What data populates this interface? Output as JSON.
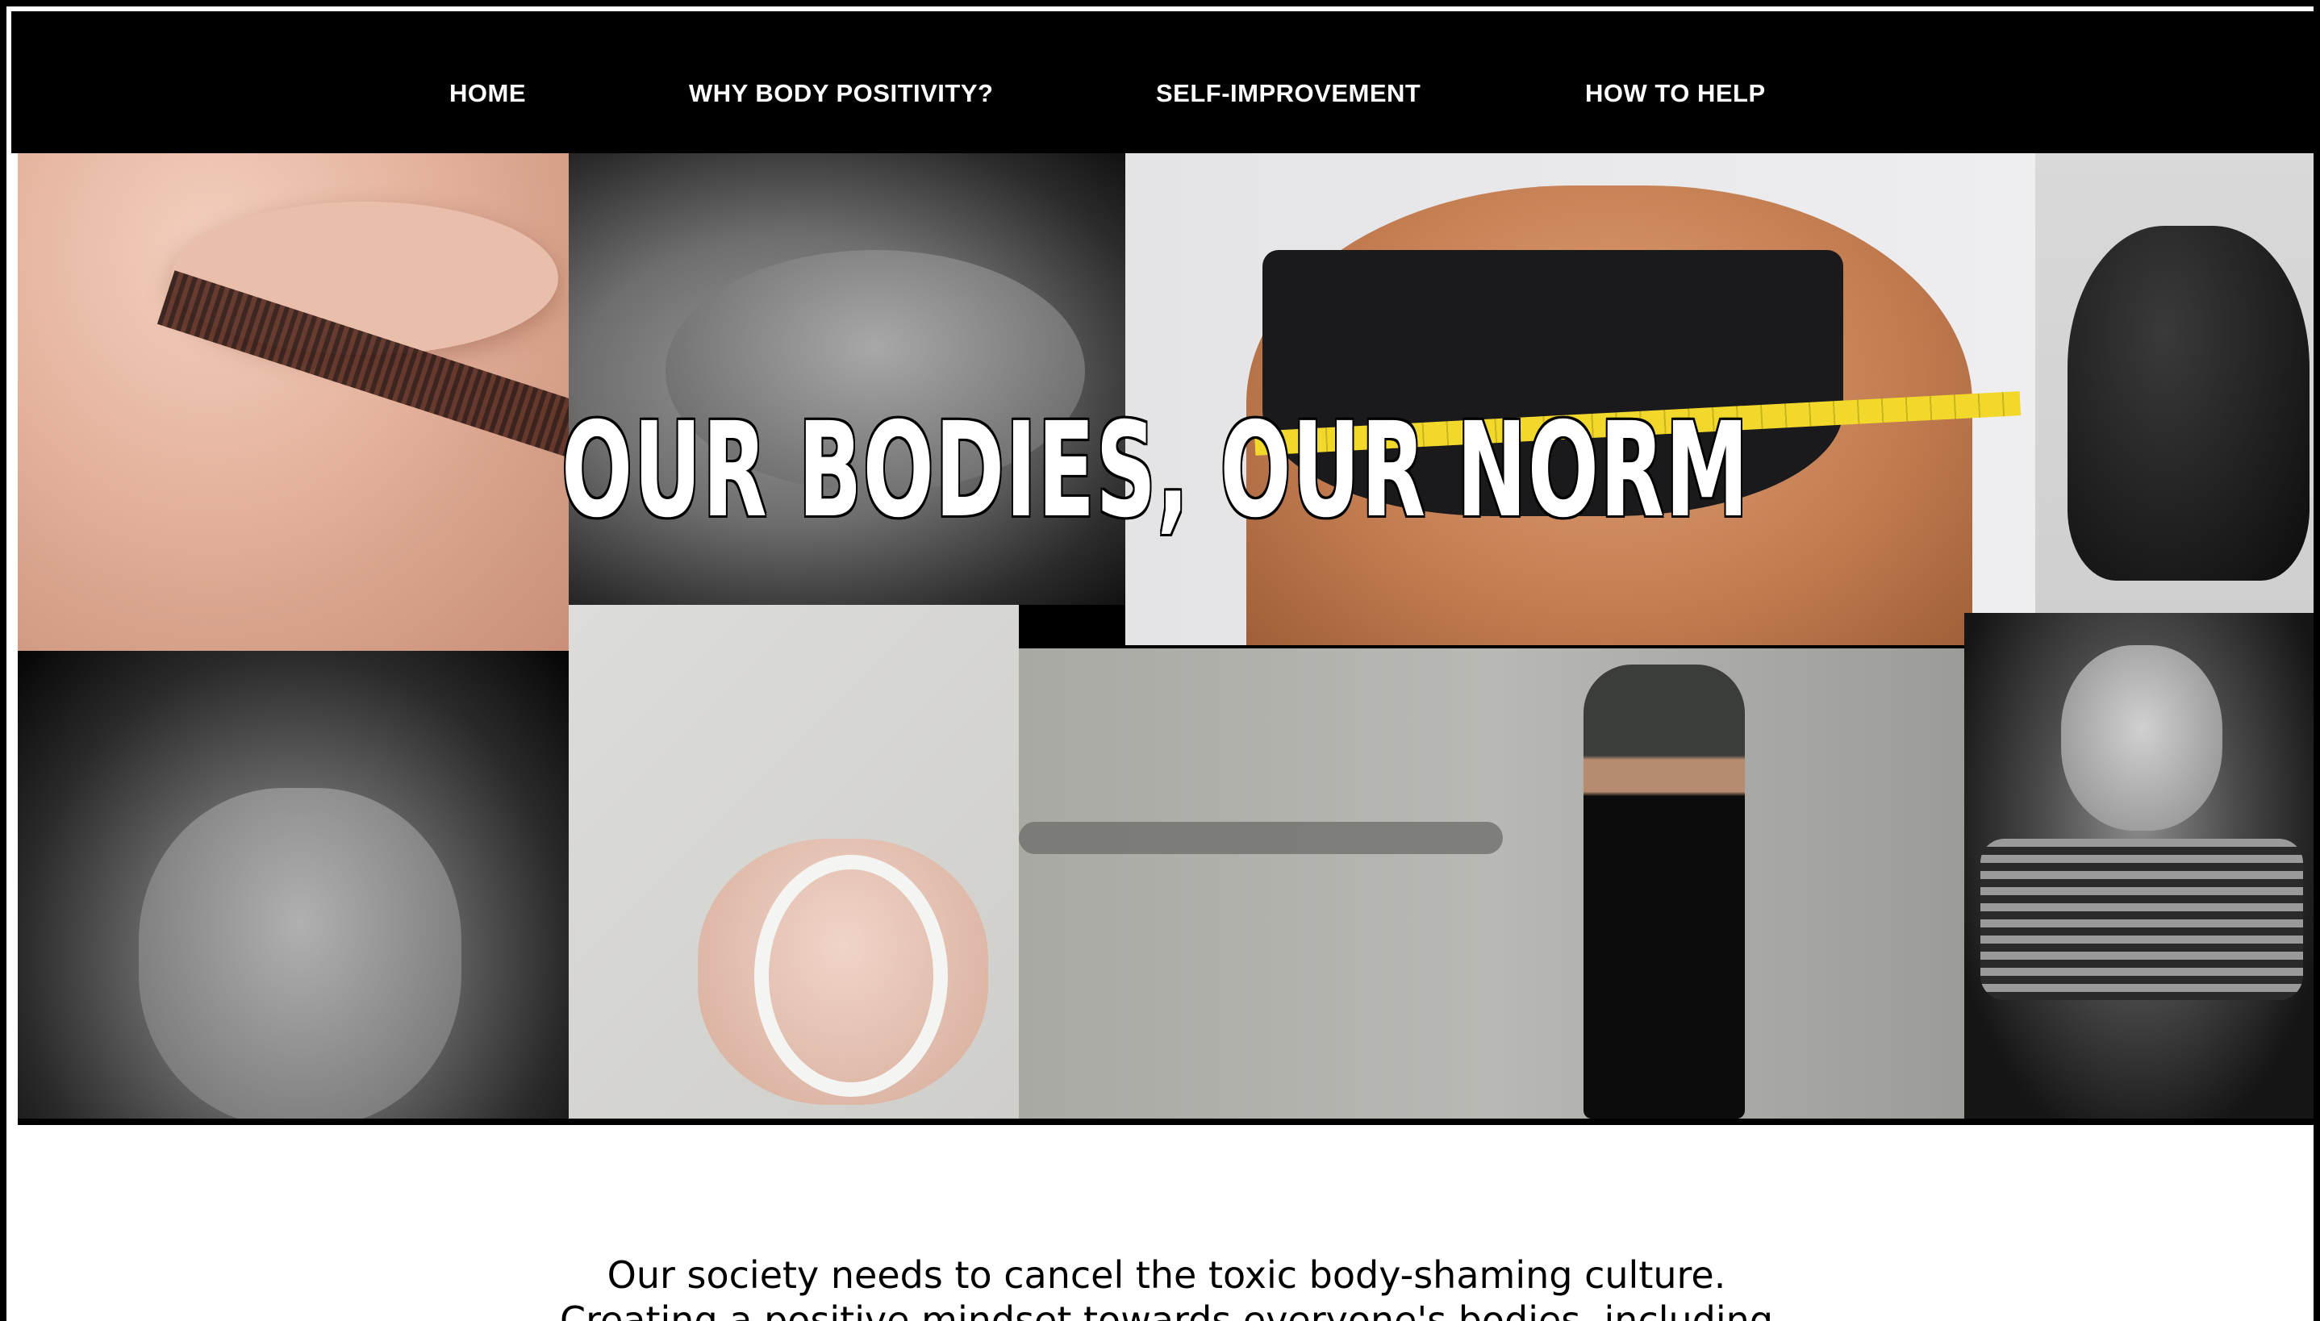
{
  "nav": {
    "items": [
      {
        "label": "HOME"
      },
      {
        "label": "WHY BODY POSITIVITY?"
      },
      {
        "label": "SELF-IMPROVEMENT"
      },
      {
        "label": "HOW TO HELP"
      }
    ]
  },
  "hero": {
    "title": "OUR BODIES, OUR NORM"
  },
  "intro": {
    "line1": "Our society needs to cancel the toxic body-shaming culture.",
    "line2": "Creating a positive mindset towards everyone's bodies, including"
  },
  "colors": {
    "nav_bg": "#000000",
    "nav_text": "#ffffff",
    "page_bg": "#ffffff",
    "text": "#000000"
  }
}
